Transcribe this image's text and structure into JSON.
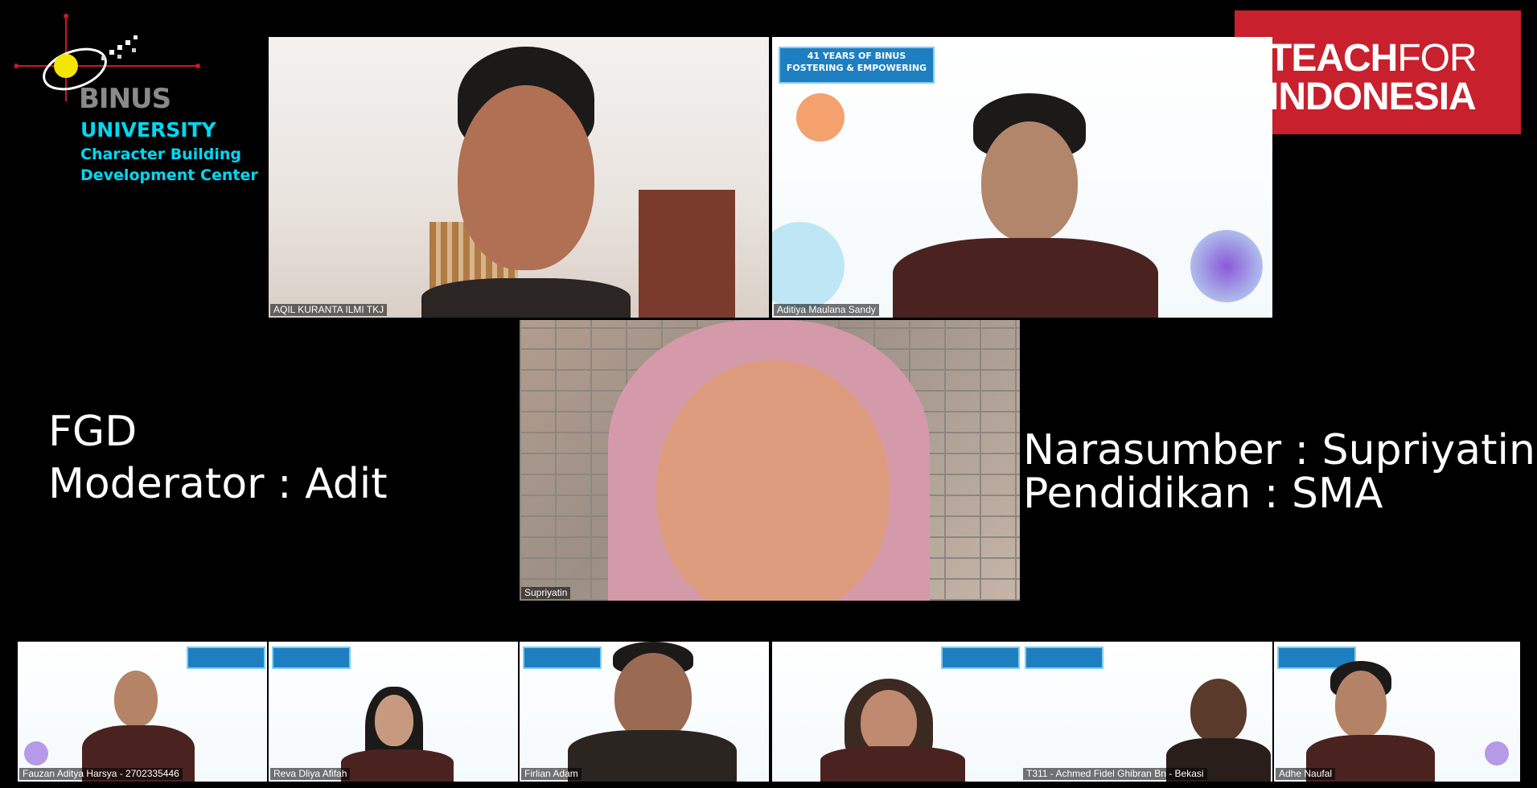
{
  "logo": {
    "brand": "BINUS",
    "university": "UNIVERSITY",
    "line1": "Character Building",
    "line2": "Development Center"
  },
  "partner_logo": {
    "line1_bold": "TEACH",
    "line1_light": "FOR",
    "line2": "INDONESIA"
  },
  "overlay": {
    "fgd": "FGD",
    "moderator": "Moderator : Adit",
    "narasumber": "Narasumber : Supriyatin",
    "pendidikan": "Pendidikan : SMA"
  },
  "banner": {
    "line1": "41 YEARS OF BINUS",
    "line2": "FOSTERING & EMPOWERING"
  },
  "participants": {
    "top_left": "AQIL KURANTA ILMI TKJ",
    "top_right": "Aditiya Maulana Sandy",
    "center": "Supriyatin",
    "bottom": [
      "Fauzan Aditya Harsya - 2702335446",
      "Reva Dliya Afifah",
      "Firlian Adam",
      "T311 - Achmed Fidel Ghibran Bn - Bekasi",
      "Adhe Naufal"
    ]
  },
  "colors": {
    "binus_cyan": "#00d9f2",
    "binus_gray": "#8a8a8a",
    "tfi_red": "#c8202c",
    "binus_blue": "#1e7fc0"
  }
}
